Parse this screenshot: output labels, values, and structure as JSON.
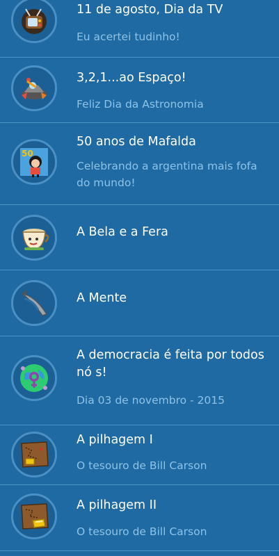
{
  "badges": [
    {
      "title": "11 de agosto, Dia da TV",
      "subtitle": "Eu acertei tudinho!",
      "icon": "tv-icon"
    },
    {
      "title": "3,2,1...ao Espaço!",
      "subtitle": "Feliz Dia da Astronomia",
      "icon": "rocket-icon"
    },
    {
      "title": "50 anos de Mafalda",
      "subtitle": "Celebrando a argentina mais fofa do mundo!",
      "icon": "mafalda-icon"
    },
    {
      "title": "A Bela e a Fera",
      "subtitle": "",
      "icon": "teacup-icon"
    },
    {
      "title": "A Mente",
      "subtitle": "",
      "icon": "blade-icon"
    },
    {
      "title": "A democracia é feita por todos nó s!",
      "subtitle": "Dia 03 de novembro - 2015",
      "icon": "earth-gender-icon"
    },
    {
      "title": "A pilhagem I",
      "subtitle": "O tesouro de Bill Carson",
      "icon": "treasure-map-icon"
    },
    {
      "title": "A pilhagem II",
      "subtitle": "O tesouro de Bill Carson",
      "icon": "treasure-map-gold-icon"
    }
  ],
  "colors": {
    "background": "#1f6aa3",
    "divider": "#4f95c8",
    "title": "#ffffff",
    "subtitle": "#8ec3e8"
  }
}
